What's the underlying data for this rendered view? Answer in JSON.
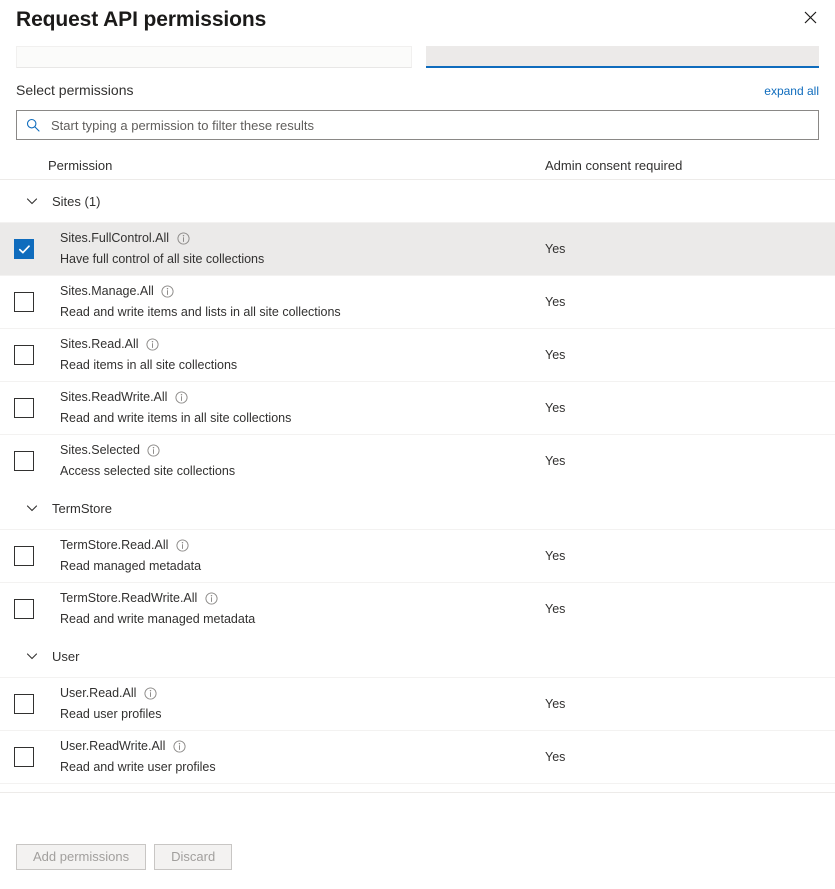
{
  "header": {
    "title": "Request API permissions",
    "close_icon": "close-icon"
  },
  "tabs": [
    {
      "label": "",
      "state": "inactive"
    },
    {
      "label": "",
      "state": "active"
    }
  ],
  "section": {
    "title": "Select permissions",
    "expand_all_label": "expand all"
  },
  "search": {
    "placeholder": "Start typing a permission to filter these results",
    "value": "",
    "icon": "search-icon"
  },
  "table": {
    "columns": {
      "permission": "Permission",
      "admin_consent": "Admin consent required"
    },
    "groups": [
      {
        "name": "Sites (1)",
        "expanded": true,
        "rows": [
          {
            "name": "Sites.FullControl.All",
            "description": "Have full control of all site collections",
            "admin_consent": "Yes",
            "checked": true
          },
          {
            "name": "Sites.Manage.All",
            "description": "Read and write items and lists in all site collections",
            "admin_consent": "Yes",
            "checked": false
          },
          {
            "name": "Sites.Read.All",
            "description": "Read items in all site collections",
            "admin_consent": "Yes",
            "checked": false
          },
          {
            "name": "Sites.ReadWrite.All",
            "description": "Read and write items in all site collections",
            "admin_consent": "Yes",
            "checked": false
          },
          {
            "name": "Sites.Selected",
            "description": "Access selected site collections",
            "admin_consent": "Yes",
            "checked": false
          }
        ]
      },
      {
        "name": "TermStore",
        "expanded": true,
        "rows": [
          {
            "name": "TermStore.Read.All",
            "description": "Read managed metadata",
            "admin_consent": "Yes",
            "checked": false
          },
          {
            "name": "TermStore.ReadWrite.All",
            "description": "Read and write managed metadata",
            "admin_consent": "Yes",
            "checked": false
          }
        ]
      },
      {
        "name": "User",
        "expanded": true,
        "rows": [
          {
            "name": "User.Read.All",
            "description": "Read user profiles",
            "admin_consent": "Yes",
            "checked": false
          },
          {
            "name": "User.ReadWrite.All",
            "description": "Read and write user profiles",
            "admin_consent": "Yes",
            "checked": false
          }
        ]
      }
    ]
  },
  "footer": {
    "add_permissions_label": "Add permissions",
    "discard_label": "Discard",
    "add_permissions_disabled": true,
    "discard_disabled": true
  },
  "colors": {
    "accent": "#0f6cbd",
    "link": "#0f6cbd",
    "selected_row_bg": "#ebeae9",
    "text": "#323130",
    "divider": "#edebe9"
  }
}
